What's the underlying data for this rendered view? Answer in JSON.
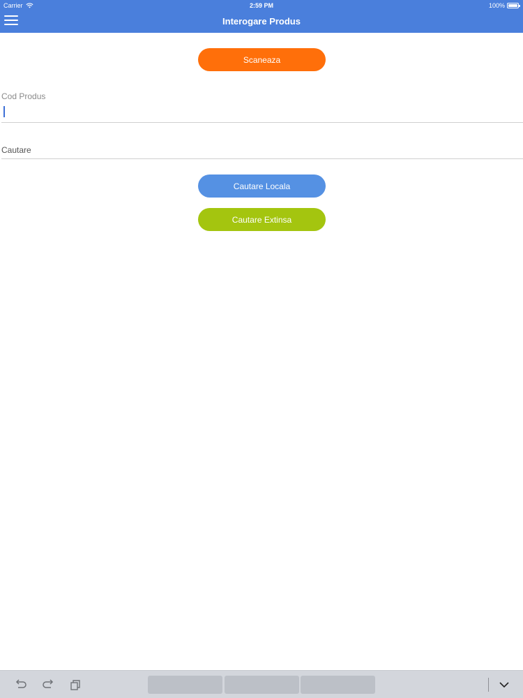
{
  "status_bar": {
    "carrier": "Carrier",
    "time": "2:59 PM",
    "battery": "100%",
    "battery_level": 1.0
  },
  "nav": {
    "title": "Interogare Produs",
    "menu_icon": "hamburger-menu-icon"
  },
  "buttons": {
    "scan": "Scaneaza",
    "local_search": "Cautare Locala",
    "extended_search": "Cautare Extinsa"
  },
  "fields": {
    "product_code_label": "Cod Produs",
    "product_code_value": "",
    "search_label": "Cautare"
  },
  "keyboard_toolbar": {
    "icons": [
      "undo-icon",
      "redo-icon",
      "paste-icon",
      "chevron-down-icon"
    ]
  },
  "colors": {
    "nav_bar": "#4a7fdc",
    "scan_button": "#ff6f0a",
    "local_search_button": "#5591e3",
    "extended_search_button": "#a4c50f"
  }
}
